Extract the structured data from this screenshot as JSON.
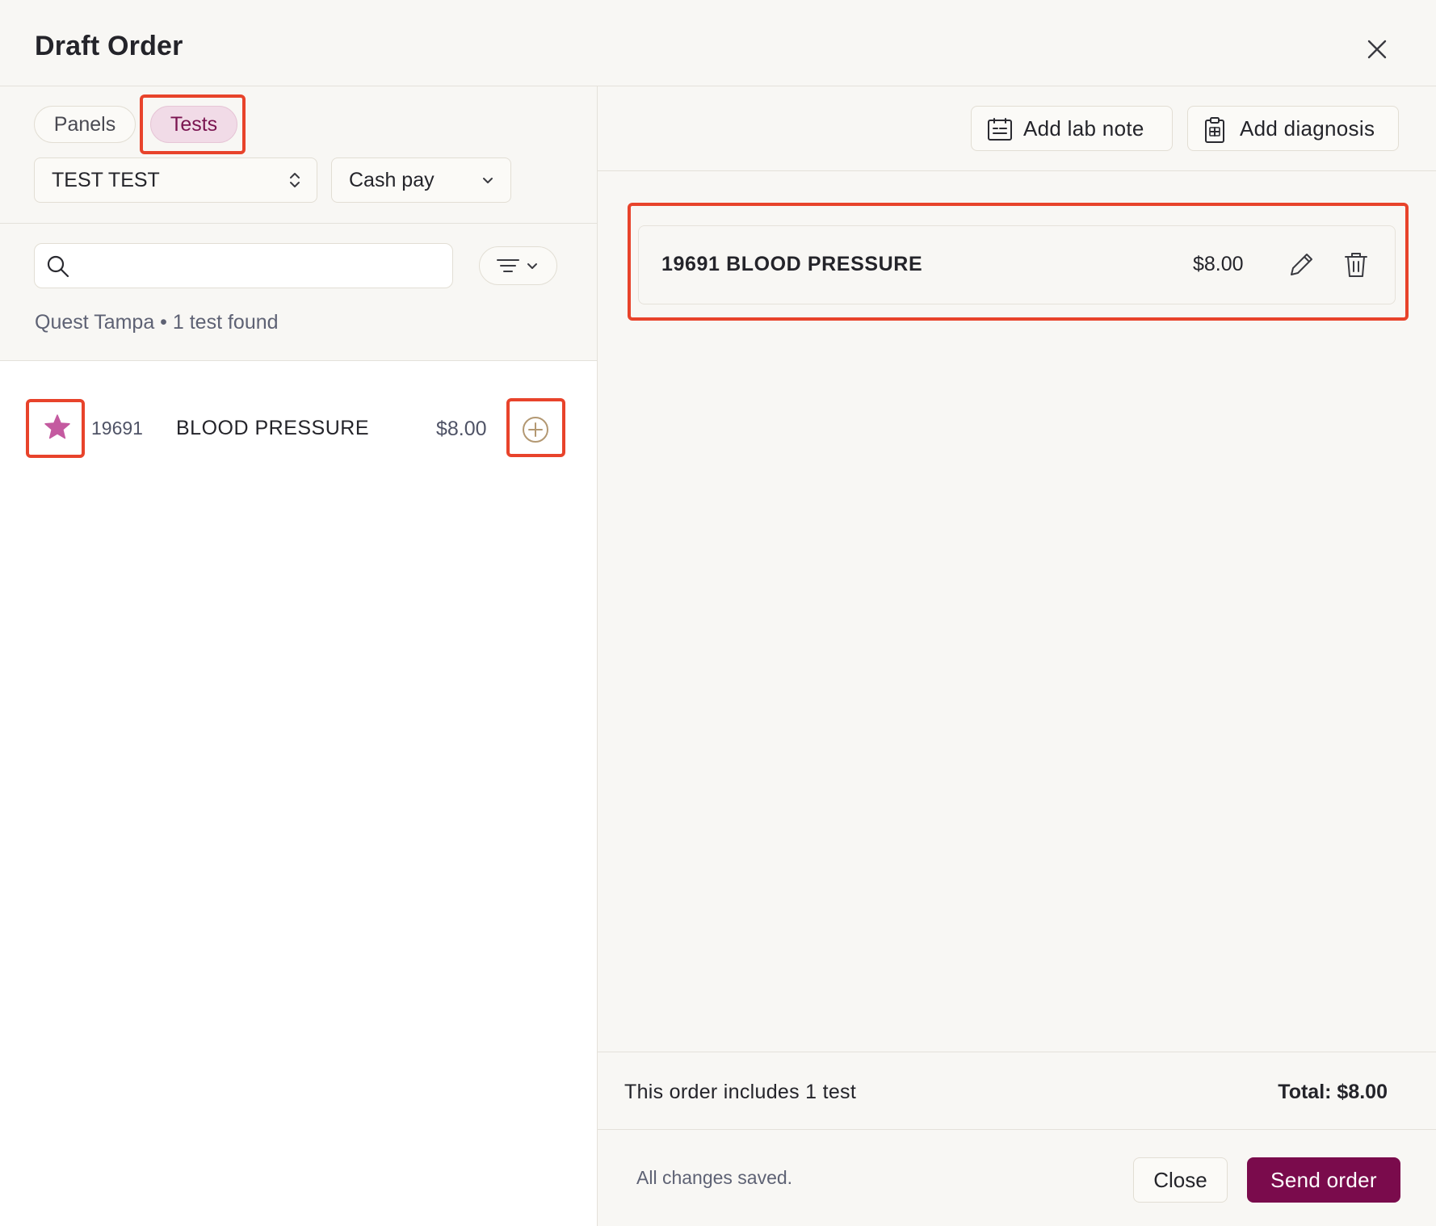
{
  "header": {
    "title": "Draft Order",
    "close_icon": "close-icon"
  },
  "left": {
    "tabs": [
      {
        "label": "Panels",
        "active": false
      },
      {
        "label": "Tests",
        "active": true
      }
    ],
    "patient_select": {
      "value": "TEST TEST"
    },
    "payment_select": {
      "value": "Cash pay"
    },
    "search": {
      "value": "",
      "placeholder": ""
    },
    "result_meta": "Quest Tampa • 1 test found",
    "results": [
      {
        "code": "19691",
        "name": "BLOOD PRESSURE",
        "price": "$8.00",
        "favorite": true
      }
    ]
  },
  "right": {
    "toolbar": {
      "add_lab_note": "Add lab note",
      "add_diagnosis": "Add diagnosis"
    },
    "order_items": [
      {
        "name": "19691 BLOOD PRESSURE",
        "price": "$8.00"
      }
    ],
    "summary": {
      "text": "This order includes 1 test",
      "total": "Total: $8.00"
    },
    "footer": {
      "status": "All changes saved.",
      "close_label": "Close",
      "send_label": "Send order"
    }
  },
  "colors": {
    "accent": "#7a0b4c",
    "highlight": "#e8432b",
    "star": "#c45aa0"
  }
}
